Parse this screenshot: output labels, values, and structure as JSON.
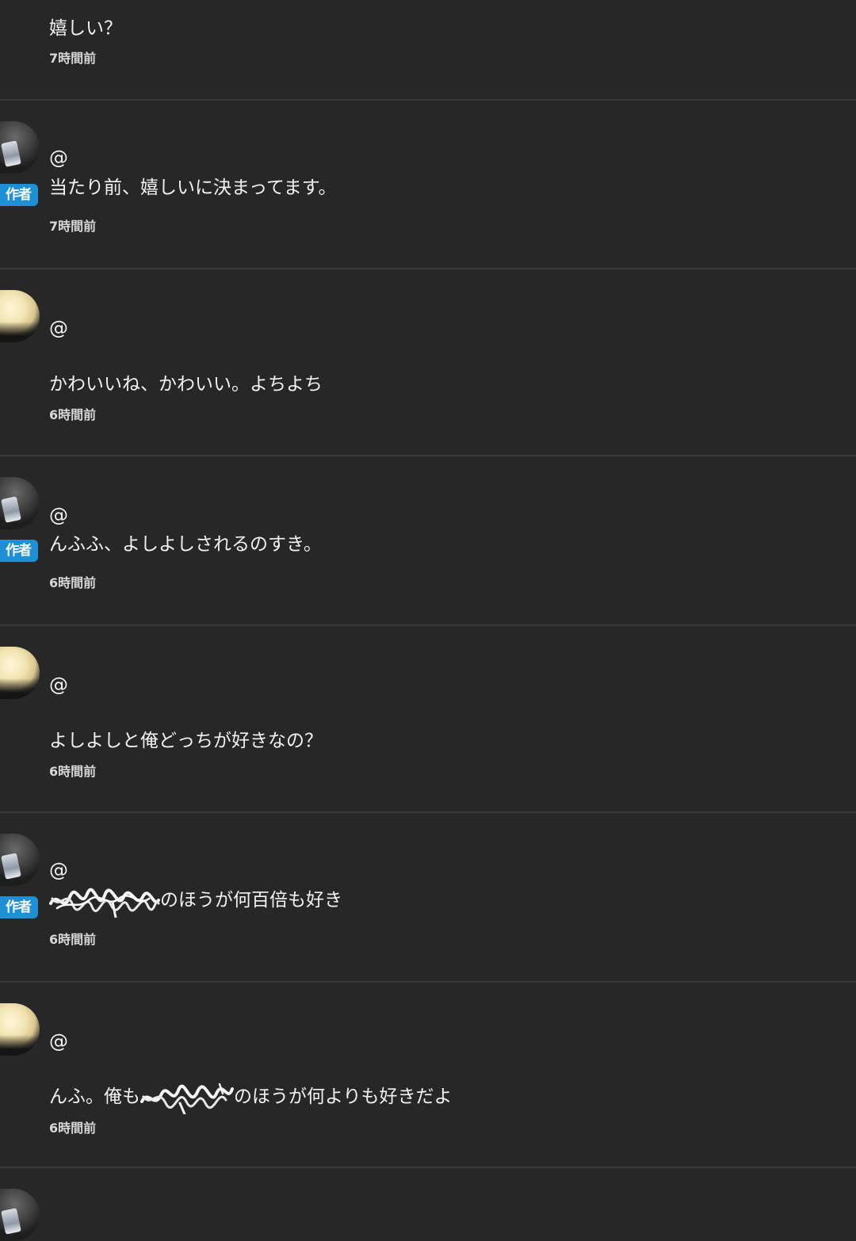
{
  "comments": [
    {
      "role": "reader",
      "mention": "",
      "text_parts": [
        "嬉しい？"
      ],
      "time": "7時間前"
    },
    {
      "role": "author",
      "badge": "作者",
      "mention": "@",
      "text_parts": [
        "当たり前、嬉しいに決まってます。"
      ],
      "time": "7時間前"
    },
    {
      "role": "reader",
      "mention": "@",
      "text_parts": [
        "かわいいね、かわいい。よちよち"
      ],
      "time": "6時間前"
    },
    {
      "role": "author",
      "badge": "作者",
      "mention": "@",
      "text_parts": [
        "んふふ、よしよしされるのすき。"
      ],
      "time": "6時間前"
    },
    {
      "role": "reader",
      "mention": "@",
      "text_parts": [
        "よしよしと俺どっちが好きなの？"
      ],
      "time": "6時間前"
    },
    {
      "role": "author",
      "badge": "作者",
      "mention": "@",
      "text_parts": [
        "のほうが何百倍も好き"
      ],
      "time": "6時間前",
      "redacted": true
    },
    {
      "role": "reader",
      "mention": "@",
      "text_parts": [
        "んふ。俺も",
        "のほうが何よりも好きだよ"
      ],
      "time": "6時間前",
      "redacted": true
    }
  ],
  "icons": {
    "author_avatar": "author-avatar-photo",
    "reader_avatar": "reader-avatar-photo",
    "redaction": "scribble-redaction"
  },
  "colors": {
    "background": "#272727",
    "badge": "#1f8fd6",
    "divider": "#3a3a3a"
  }
}
